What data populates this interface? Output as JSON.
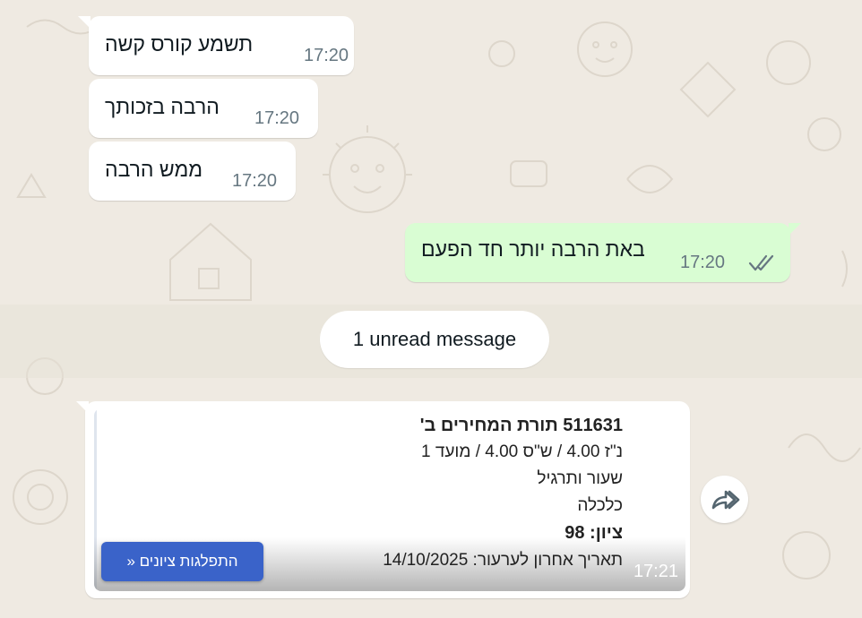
{
  "messages": [
    {
      "text": "תשמע קורס קשה",
      "time": "17:20",
      "direction": "incoming"
    },
    {
      "text": "הרבה בזכותך",
      "time": "17:20",
      "direction": "incoming"
    },
    {
      "text": "ממש הרבה",
      "time": "17:20",
      "direction": "incoming"
    },
    {
      "text": "באת הרבה יותר חד הפעם",
      "time": "17:20",
      "direction": "outgoing",
      "status": "read"
    }
  ],
  "unread_label": "1 unread message",
  "card": {
    "title": "511631 תורת המחירים ב'",
    "line1": "נ\"ז 4.00 / ש\"ס 4.00 / מועד 1",
    "line2": "שעור ותרגיל",
    "line3": "כלכלה",
    "grade": "ציון: 98",
    "appeal_deadline": "תאריך אחרון לערעור: 14/10/2025",
    "button_label": "התפלגות ציונים «",
    "time": "17:21"
  },
  "icons": {
    "read_receipt": "double-check-icon",
    "forward": "forward-icon"
  },
  "colors": {
    "background": "#efeae2",
    "incoming_bubble": "#ffffff",
    "outgoing_bubble": "#d9fdd3",
    "read_ticks": "#53bdeb",
    "card_button": "#3a63c9"
  }
}
